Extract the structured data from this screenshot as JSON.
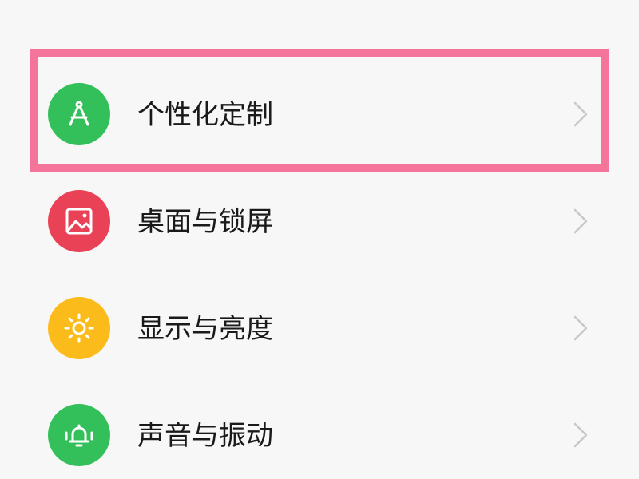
{
  "settings": {
    "items": [
      {
        "label": "个性化定制",
        "icon": "compass-icon",
        "icon_color": "#33c05a"
      },
      {
        "label": "桌面与锁屏",
        "icon": "image-icon",
        "icon_color": "#e94256"
      },
      {
        "label": "显示与亮度",
        "icon": "sun-icon",
        "icon_color": "#fbbb1a"
      },
      {
        "label": "声音与振动",
        "icon": "bell-vibrate-icon",
        "icon_color": "#33c05a"
      }
    ]
  },
  "highlight": {
    "color": "#f5749a",
    "target": "个性化定制"
  }
}
